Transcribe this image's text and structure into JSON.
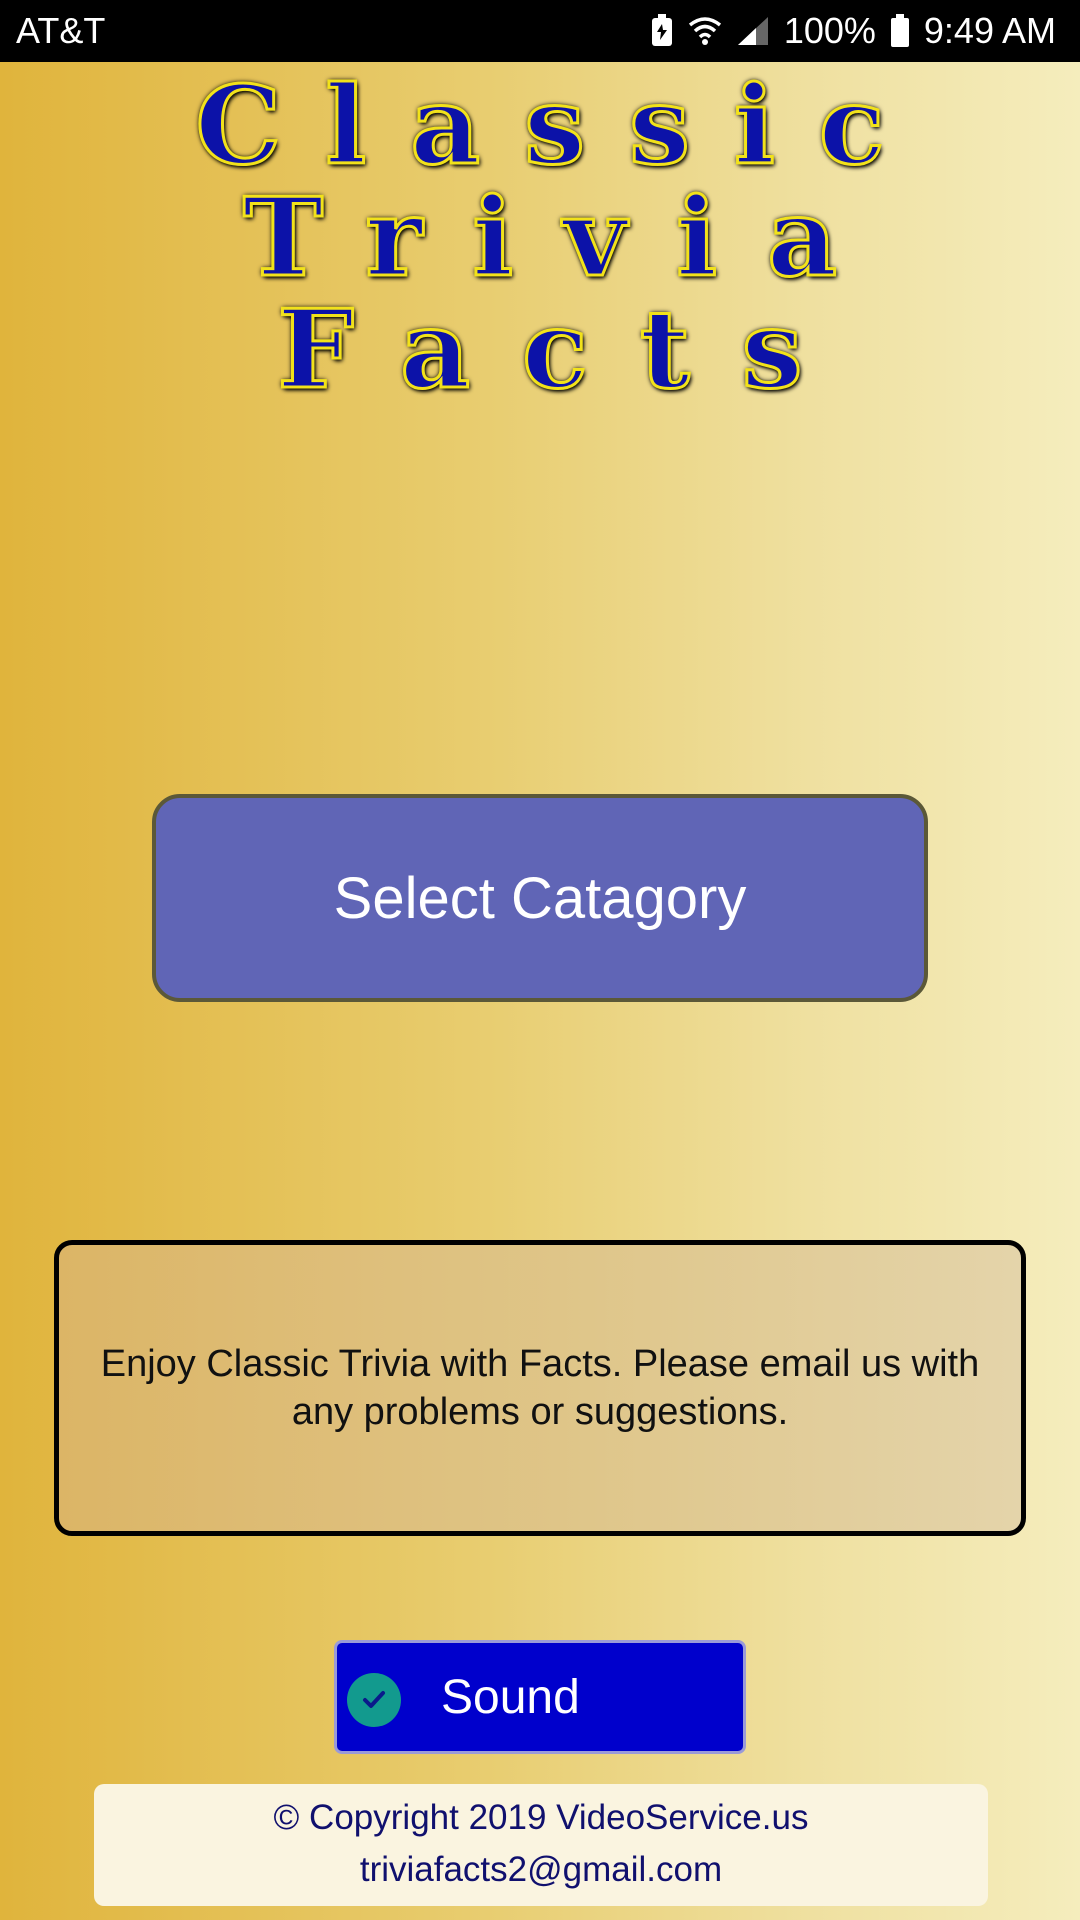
{
  "status_bar": {
    "carrier": "AT&T",
    "battery_percent": "100%",
    "time": "9:49 AM",
    "icons": [
      "battery-saver-icon",
      "wifi-icon",
      "signal-icon",
      "battery-icon"
    ]
  },
  "logo": {
    "line1": "Classic",
    "line2": "Trivia",
    "line3": "Facts"
  },
  "main": {
    "select_button_label": "Select Catagory",
    "info_text": "Enjoy Classic Trivia with Facts. Please email us with any problems or suggestions.",
    "sound_label": "Sound",
    "sound_checked": true
  },
  "footer": {
    "copyright": "© Copyright 2019 VideoService.us",
    "email": "triviafacts2@gmail.com"
  },
  "colors": {
    "background_start": "#e0b43c",
    "background_end": "#f5edbd",
    "button": "#6065b6",
    "sound_toggle": "#0000cc",
    "check": "#129a8e",
    "logo_fill": "#0c12a8",
    "logo_outline": "#f2e21a"
  }
}
